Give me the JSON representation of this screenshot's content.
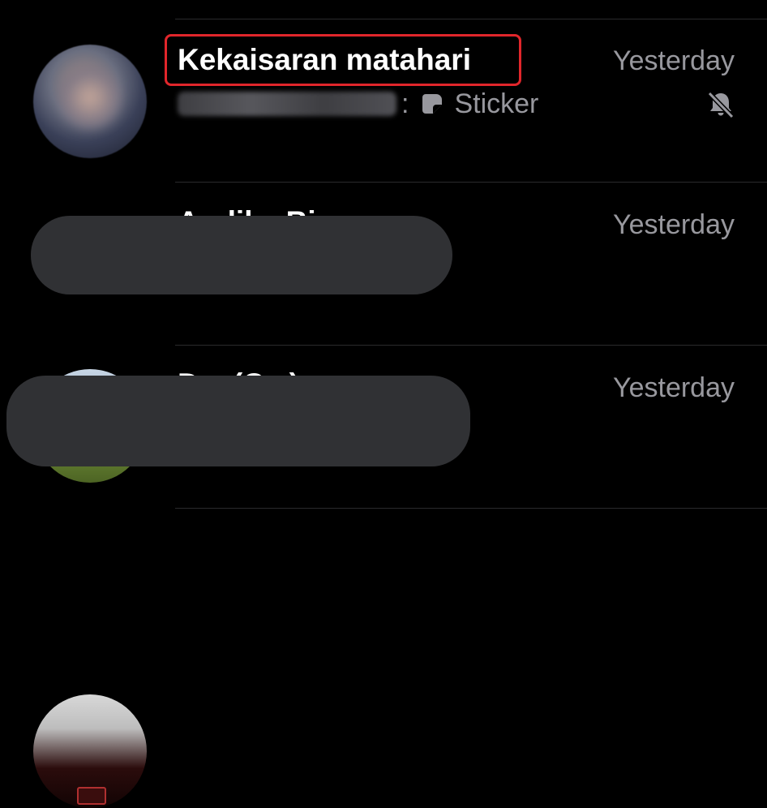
{
  "chats": [
    {
      "name": "Kekaisaran matahari",
      "time": "Yesterday",
      "preview_separator": ":",
      "preview_text": "Sticker",
      "sticker_icon": "sticker-icon",
      "muted": true,
      "mute_icon": "muted-bell-icon",
      "highlighted": true,
      "highlight_color": "#e1262b"
    },
    {
      "name": "Andika Bi...",
      "time": "Yesterday",
      "redacted": true
    },
    {
      "name": "D... (C...)",
      "time": "Yesterday",
      "redacted": true
    }
  ],
  "colors": {
    "background": "#000000",
    "name_text": "#ffffff",
    "secondary_text": "#98989e",
    "divider": "#2a2a2c",
    "redaction": "#303134"
  }
}
